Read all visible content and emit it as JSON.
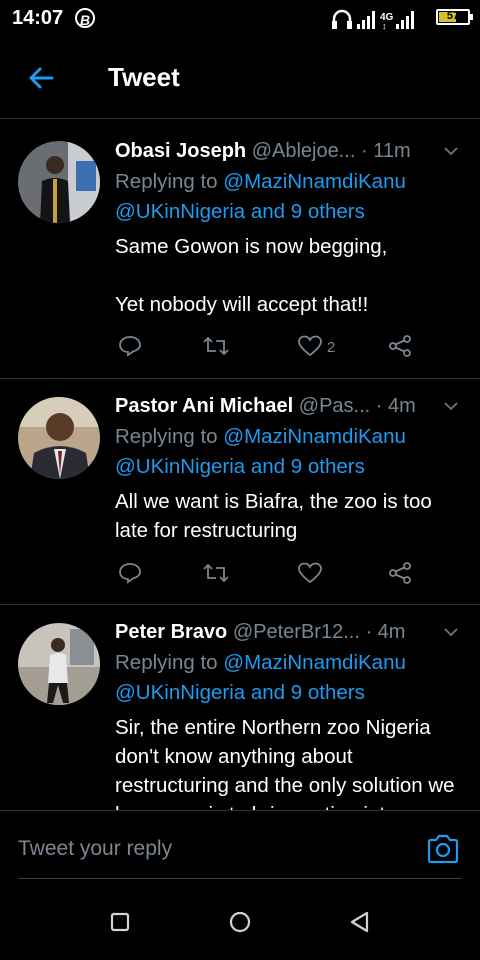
{
  "status": {
    "time": "14:07",
    "battery": "57"
  },
  "header": {
    "title": "Tweet"
  },
  "tweets": [
    {
      "name": "Obasi Joseph",
      "handle": "@Ablejoe...",
      "time": "· 11m",
      "reply_prefix": "Replying to ",
      "reply_to": "@MaziNnamdiKanu",
      "reply_others": "@UKinNigeria and 9 others",
      "text": "Same Gowon is now begging,\n\nYet nobody will accept that!!",
      "likes": "2"
    },
    {
      "name": "Pastor Ani Michael",
      "handle": "@Pas...",
      "time": "· 4m",
      "reply_prefix": "Replying to ",
      "reply_to": "@MaziNnamdiKanu",
      "reply_others": "@UKinNigeria and 9 others",
      "text": "All we want is Biafra, the zoo is too late for restructuring",
      "likes": ""
    },
    {
      "name": "Peter Bravo",
      "handle": "@PeterBr12...",
      "time": "· 4m",
      "reply_prefix": "Replying to ",
      "reply_to": "@MaziNnamdiKanu",
      "reply_others": "@UKinNigeria and 9 others",
      "text": "Sir, the entire Northern zoo Nigeria don't know anything about restructuring and the only solution we have now is to bring action into",
      "likes": ""
    }
  ],
  "compose": {
    "placeholder": "Tweet your reply"
  },
  "colors": {
    "link": "#1d9bf0",
    "muted": "#7a8690",
    "background": "#000000"
  }
}
